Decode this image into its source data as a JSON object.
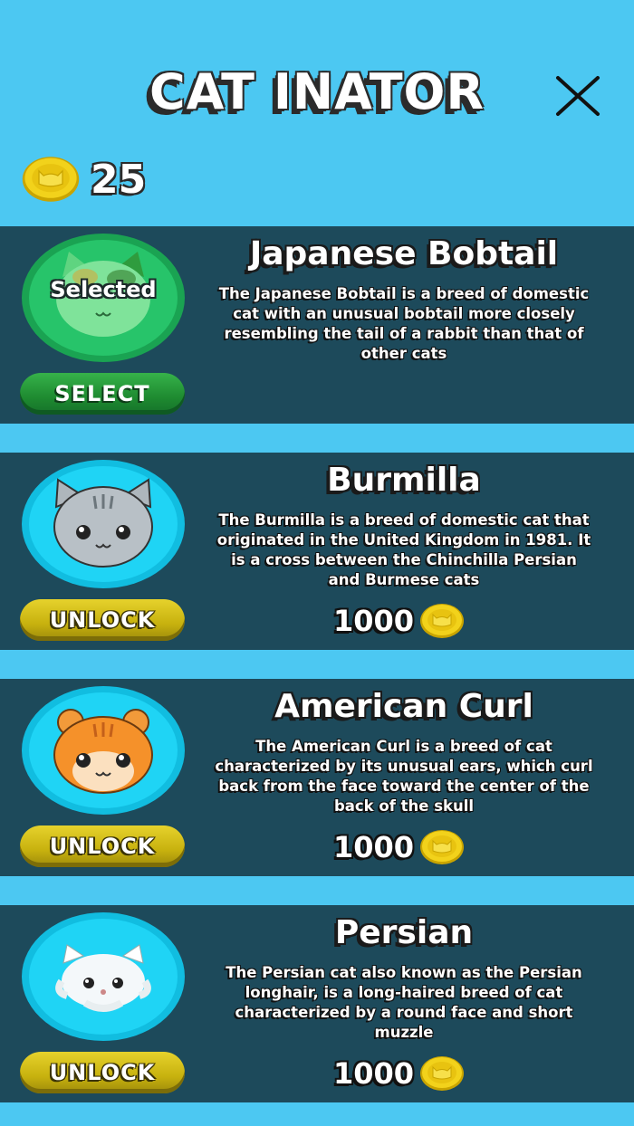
{
  "header": {
    "title": "CAT INATOR",
    "close_icon": "close-icon"
  },
  "wallet": {
    "icon": "coin-icon",
    "count": "25"
  },
  "colors": {
    "background": "#4cc8f2",
    "card": "#1d4a5b",
    "select_button": "#1e8a30",
    "unlock_button": "#c7b10e",
    "avatar_cyan": "#1fd4f5",
    "avatar_selected": "#27c46a"
  },
  "cats": [
    {
      "name": "Japanese Bobtail",
      "description": "The Japanese Bobtail is a breed of domestic cat with an unusual bobtail more closely resembling the tail of a rabbit than that of other cats",
      "status": "Selected",
      "button": "SELECT",
      "icon": "calico-cat-icon"
    },
    {
      "name": "Burmilla",
      "description": "The Burmilla is a breed of domestic cat that originated in the United Kingdom in 1981. It is a cross between the Chinchilla Persian and Burmese cats",
      "button": "UNLOCK",
      "price": "1000",
      "icon": "gray-tabby-cat-icon"
    },
    {
      "name": "American Curl",
      "description": "The American Curl is a breed of cat characterized by its unusual ears, which curl back from the face toward the center of the back of the skull",
      "button": "UNLOCK",
      "price": "1000",
      "icon": "orange-cat-icon"
    },
    {
      "name": "Persian",
      "description": "The Persian cat also known as the Persian longhair, is a long-haired breed of cat characterized by a round face and short muzzle",
      "button": "UNLOCK",
      "price": "1000",
      "icon": "white-persian-cat-icon"
    }
  ]
}
